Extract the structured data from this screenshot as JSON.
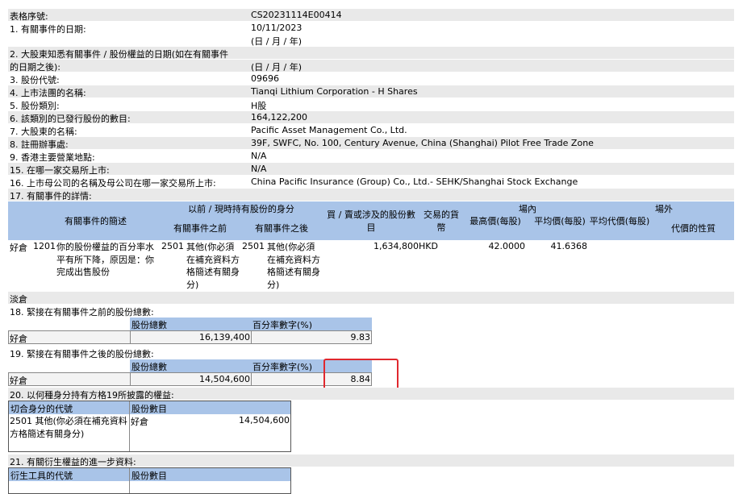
{
  "rows": [
    {
      "label": "表格序號:",
      "value": "CS20231114E00414"
    },
    {
      "label": "1. 有關事件的日期:",
      "value": "10/11/2023"
    },
    {
      "label": "",
      "value": "(日 / 月 / 年)"
    },
    {
      "label": "2. 大股東知悉有關事件 / 股份權益的日期(如在有關事件",
      "value": ""
    },
    {
      "label": "的日期之後):",
      "value": "(日 / 月 / 年)"
    },
    {
      "label": "3. 股份代號:",
      "value": "09696"
    },
    {
      "label": "4. 上市法團的名稱:",
      "value": "Tianqi Lithium Corporation - H Shares"
    },
    {
      "label": "5. 股份類別:",
      "value": "H股"
    },
    {
      "label": "6. 該類別的已發行股份的數目:",
      "value": "164,122,200"
    },
    {
      "label": "7. 大股東的名稱:",
      "value": "Pacific Asset Management Co., Ltd."
    },
    {
      "label": "8. 註冊辦事處:",
      "value": "39F, SWFC, No. 100, Century Avenue, China (Shanghai) Pilot Free Trade Zone"
    },
    {
      "label": "9. 香港主要營業地點:",
      "value": "N/A"
    },
    {
      "label": "15. 在哪一家交易所上市:",
      "value": "N/A"
    },
    {
      "label": "16. 上市母公司的名稱及母公司在哪一家交易所上市:",
      "value": "China Pacific Insurance (Group) Co., Ltd.- SEHK/Shanghai Stock Exchange"
    },
    {
      "label": "17. 有關事件的詳情:",
      "value": ""
    }
  ],
  "event_table": {
    "headers": {
      "event_code": "有關事件的簡述",
      "capacity_group": "以前 / 現時持有股份的身分",
      "before": "有關事件之前",
      "after": "有關事件之後",
      "shares": "買 / 賣或涉及的股份數目",
      "currency": "交易的貨幣",
      "on_exchange": "場內",
      "highest": "最高價(每股)",
      "average": "平均價(每股)",
      "off_exchange": "場外",
      "avg_consideration": "平均代價(每股)",
      "nature": "代價的性質"
    },
    "row": {
      "position": "好倉",
      "code": "1201",
      "desc": "你的股份權益的百分率水平有所下降，原因是：你完成出售股份",
      "before_code": "2501",
      "before_text": "其他(你必須在補充資料方格簡述有關身分)",
      "after_code": "2501",
      "after_text": "其他(你必須在補充資料方格簡述有關身分)",
      "shares": "1,634,800",
      "currency": "HKD",
      "highest": "42.0000",
      "average": "41.6368"
    }
  },
  "short_label": "淡倉",
  "s18": {
    "title": "18. 緊接在有關事件之前的股份總數:",
    "col1": "股份總數",
    "col2": "百分率數字(%)",
    "label": "好倉",
    "shares": "16,139,400",
    "pct": "9.83"
  },
  "s19": {
    "title": "19. 緊接在有關事件之後的股份總數:",
    "col1": "股份總數",
    "col2": "百分率數字(%)",
    "label": "好倉",
    "shares": "14,504,600",
    "pct": "8.84"
  },
  "s20": {
    "title": "20. 以何種身分持有方格19所披露的權益:",
    "col1": "切合身分的代號",
    "col2": "股份數目",
    "code_text": "2501 其他(你必須在補充資料方格簡述有關身分)",
    "label": "好倉",
    "shares": "14,504,600"
  },
  "s21": {
    "title": "21. 有關衍生權益的進一步資料:",
    "col1": "衍生工具的代號",
    "col2": "股份數目"
  },
  "colors": {
    "header_blue": "#a9c4e8",
    "row_gray": "#e9e9e9",
    "highlight_red": "#e0282e"
  }
}
